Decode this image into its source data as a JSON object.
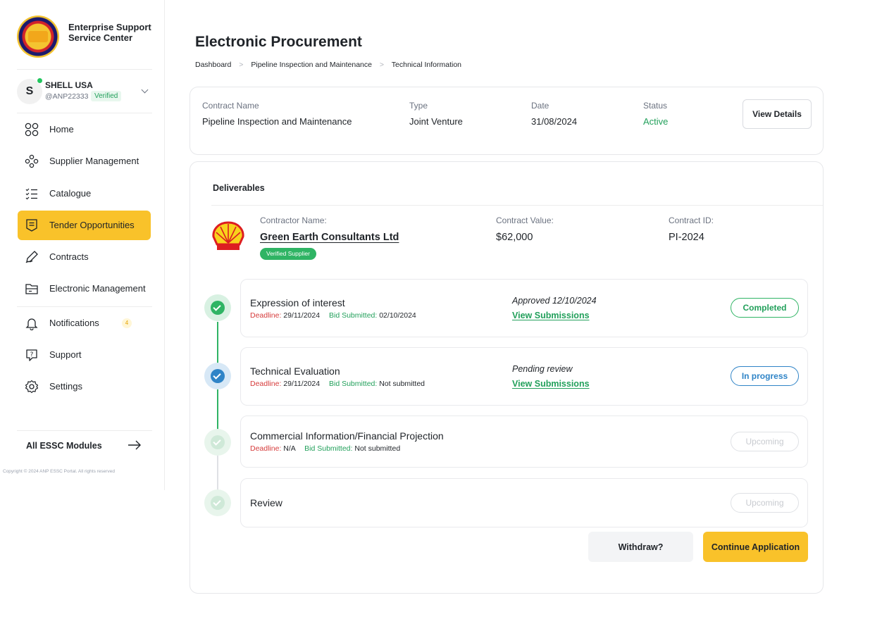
{
  "brand": {
    "name": "Enterprise Support Service Center",
    "logo_icon": "essc-seal-logo"
  },
  "account": {
    "initial": "S",
    "name": "SHELL USA",
    "handle": "@ANP22333",
    "verified_label": "Verified",
    "online_color": "#22c55e"
  },
  "nav": {
    "items": [
      {
        "label": "Home",
        "icon": "home-grid-icon"
      },
      {
        "label": "Supplier Management",
        "icon": "supplier-network-icon"
      },
      {
        "label": "Catalogue",
        "icon": "catalogue-list-icon"
      },
      {
        "label": "Tender Opportunities",
        "icon": "tender-document-icon",
        "active": true
      },
      {
        "label": "Contracts",
        "icon": "contract-pen-icon"
      },
      {
        "label": "Electronic Management",
        "icon": "folder-icon"
      },
      {
        "label": "Notifications",
        "icon": "bell-icon",
        "badge": "4"
      },
      {
        "label": "Support",
        "icon": "help-chat-icon"
      },
      {
        "label": "Settings",
        "icon": "gear-icon"
      }
    ],
    "active_color": "#f9c22a"
  },
  "footer": {
    "modules_label": "All ESSC Modules",
    "copyright": "Copyright © 2024 ANP ESSC Portal. All rights reserved"
  },
  "page": {
    "title": "Electronic Procurement",
    "breadcrumb": [
      "Dashboard",
      "Pipeline Inspection and Maintenance",
      "Technical Information"
    ]
  },
  "summary": {
    "contract_name_label": "Contract Name",
    "contract_name": "Pipeline Inspection and Maintenance",
    "type_label": "Type",
    "type": "Joint Venture",
    "date_label": "Date",
    "date": "31/08/2024",
    "status_label": "Status",
    "status": "Active",
    "view_details_label": "View Details"
  },
  "deliverables": {
    "title": "Deliverables",
    "contractor_label": "Contractor Name:",
    "contractor_name": "Green Earth Consultants Ltd",
    "supplier_tag": "Verified Supplier",
    "value_label": "Contract Value:",
    "value": "$62,000",
    "id_label": "Contract ID:",
    "id": "PI-2024",
    "logo_icon": "shell-logo-icon"
  },
  "steps": [
    {
      "title": "Expression of interest",
      "deadline_label": "Deadline:",
      "deadline": "29/11/2024",
      "bid_label": "Bid Submitted:",
      "bid": "02/10/2024",
      "status_text": "Approved 12/10/2024",
      "link": "View Submissions",
      "pill": "Completed",
      "state": "completed"
    },
    {
      "title": "Technical Evaluation",
      "deadline_label": "Deadline:",
      "deadline": "29/11/2024",
      "bid_label": "Bid Submitted:",
      "bid": "Not submitted",
      "status_text": "Pending review",
      "link": "View Submissions",
      "pill": "In progress",
      "state": "in-progress"
    },
    {
      "title": "Commercial Information/Financial Projection",
      "deadline_label": "Deadline:",
      "deadline": "N/A",
      "bid_label": "Bid Submitted:",
      "bid": "Not submitted",
      "pill": "Upcoming",
      "state": "upcoming"
    },
    {
      "title": "Review",
      "pill": "Upcoming",
      "state": "upcoming"
    }
  ],
  "actions": {
    "withdraw_label": "Withdraw?",
    "continue_label": "Continue Application"
  },
  "colors": {
    "green": "#22a05b",
    "blue": "#2f84c7",
    "red": "#d63b3b",
    "yellow": "#f9c22a"
  }
}
